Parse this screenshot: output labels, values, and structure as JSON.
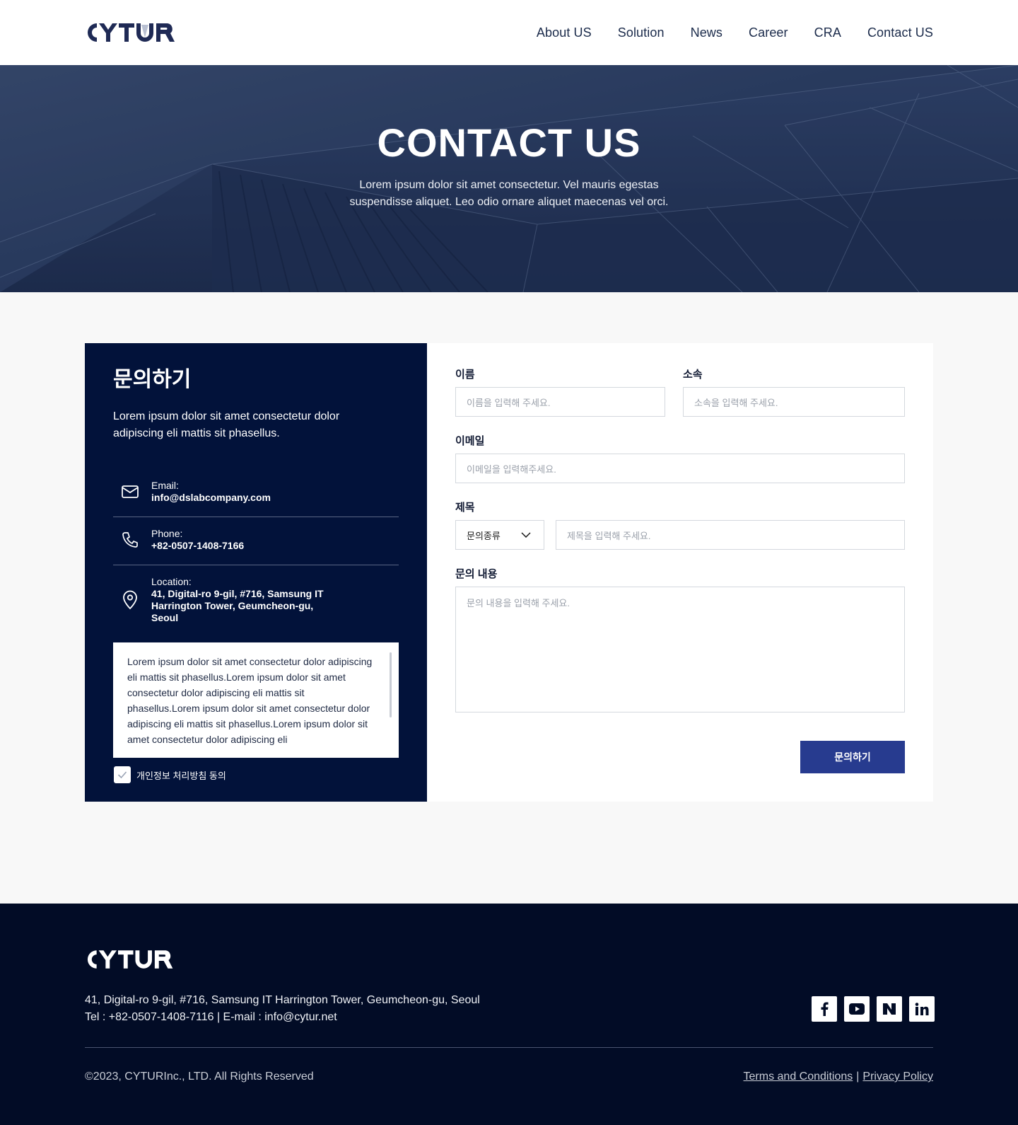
{
  "header": {
    "brand": "CYTUR",
    "nav": [
      {
        "label": "About US"
      },
      {
        "label": "Solution"
      },
      {
        "label": "News"
      },
      {
        "label": "Career"
      },
      {
        "label": "CRA"
      },
      {
        "label": "Contact US"
      }
    ]
  },
  "hero": {
    "title": "CONTACT US",
    "subtitle": "Lorem ipsum dolor sit amet consectetur.  Vel mauris egestas suspendisse aliquet. Leo odio ornare aliquet maecenas vel orci."
  },
  "contact_panel": {
    "title": "문의하기",
    "description": "Lorem ipsum dolor sit amet consectetur dolor adipiscing eli mattis sit phasellus.",
    "email": {
      "label": "Email:",
      "value": "info@dslabcompany.com",
      "icon": "mail-icon"
    },
    "phone": {
      "label": "Phone:",
      "value": "+82-0507-1408-7166",
      "icon": "phone-icon"
    },
    "location": {
      "label": "Location:",
      "value": "41, Digital-ro 9-gil, #716, Samsung IT Harrington Tower, Geumcheon-gu, Seoul",
      "icon": "location-pin-icon"
    },
    "terms_text": "Lorem ipsum dolor sit amet consectetur dolor adipiscing eli mattis sit phasellus.Lorem ipsum dolor sit amet consectetur dolor adipiscing eli mattis sit phasellus.Lorem ipsum dolor sit amet consectetur dolor adipiscing eli mattis sit phasellus.Lorem ipsum dolor sit amet consectetur dolor adipiscing eli",
    "agree_label": "개인정보 처리방침 동의",
    "agree_checked": true
  },
  "form": {
    "name": {
      "label": "이름",
      "placeholder": "이름을 입력해 주세요."
    },
    "affiliation": {
      "label": "소속",
      "placeholder": "소속을 입력해 주세요."
    },
    "email": {
      "label": "이메일",
      "placeholder": "이메일을 입력해주세요."
    },
    "subject": {
      "label": "제목",
      "category_value": "문의종류",
      "placeholder": "제목을 입력해 주세요."
    },
    "message": {
      "label": "문의 내용",
      "placeholder": "문의 내용을 입력해 주세요."
    },
    "submit_label": "문의하기"
  },
  "footer": {
    "brand": "CYTUR",
    "address": "41, Digital-ro 9-gil, #716, Samsung IT Harrington Tower, Geumcheon-gu, Seoul",
    "contact": "Tel : +82-0507-1408-7116 | E-mail : info@cytur.net",
    "copyright": "©2023, CYTURInc., LTD. All Rights Reserved",
    "terms_link": "Terms and Conditions",
    "separator": "|",
    "privacy_link": "Privacy Policy",
    "socials": [
      {
        "name": "facebook-icon",
        "glyph": "f"
      },
      {
        "name": "youtube-icon",
        "glyph": "▶"
      },
      {
        "name": "naver-icon",
        "glyph": "N"
      },
      {
        "name": "linkedin-icon",
        "glyph": "in"
      }
    ]
  },
  "colors": {
    "navy": "#02123a",
    "footer_bg": "#020c26",
    "accent_button": "#273b8f",
    "text_dark": "#1a2a4a"
  }
}
